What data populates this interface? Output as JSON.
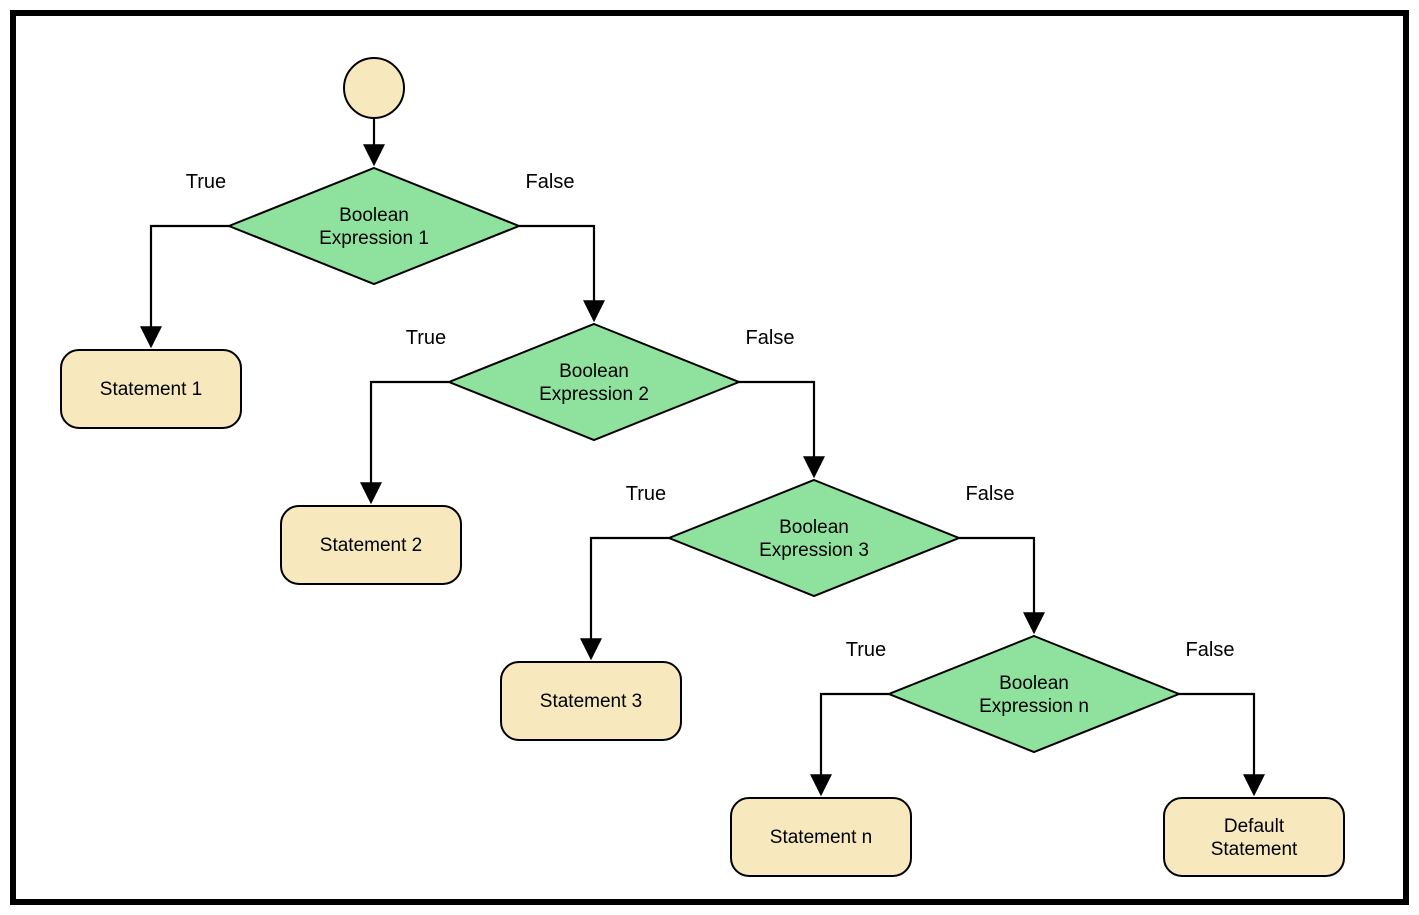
{
  "labels": {
    "trueLabel": "True",
    "falseLabel": "False"
  },
  "decisions": [
    {
      "line1": "Boolean",
      "line2": "Expression 1"
    },
    {
      "line1": "Boolean",
      "line2": "Expression 2"
    },
    {
      "line1": "Boolean",
      "line2": "Expression 3"
    },
    {
      "line1": "Boolean",
      "line2": "Expression n"
    }
  ],
  "statements": [
    {
      "line1": "Statement 1"
    },
    {
      "line1": "Statement 2"
    },
    {
      "line1": "Statement 3"
    },
    {
      "line1": "Statement n"
    },
    {
      "line1": "Default",
      "line2": "Statement"
    }
  ],
  "colors": {
    "decisionFill": "#8fe29d",
    "statementFill": "#f7e8bd",
    "stroke": "#000000"
  }
}
